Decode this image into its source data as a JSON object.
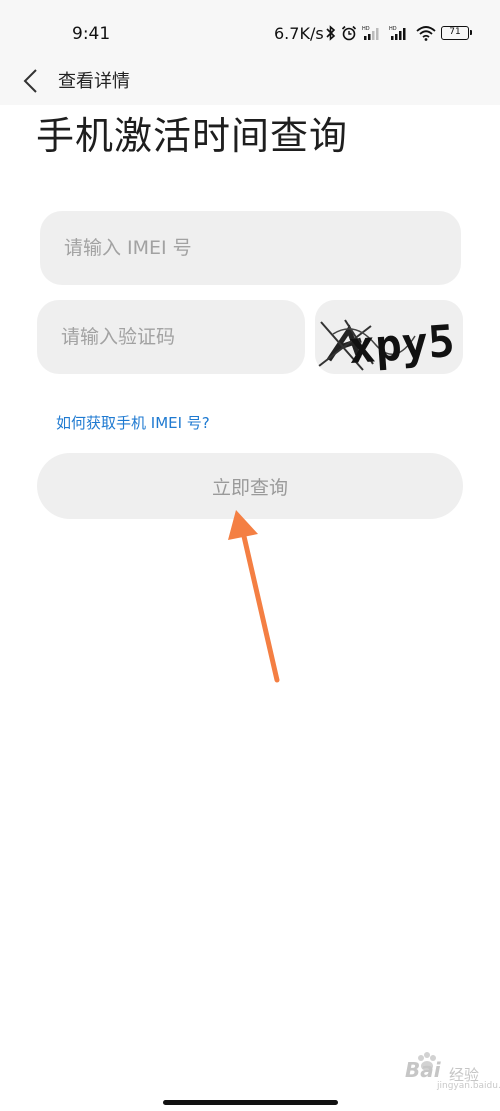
{
  "status_bar": {
    "time": "9:41",
    "network_speed": "6.7K/s",
    "battery": "71"
  },
  "header": {
    "title": "查看详情"
  },
  "page": {
    "title": "手机激活时间查询"
  },
  "form": {
    "imei_placeholder": "请输入 IMEI 号",
    "captcha_placeholder": "请输入验证码",
    "captcha_text": "xpy5",
    "help_link": "如何获取手机 IMEI 号?",
    "submit_label": "立即查询"
  },
  "annotation": {
    "arrow_color": "#f47f43"
  },
  "watermark": {
    "brand": "Bai",
    "brand_sub": "经验",
    "url": "jingyan.baidu.com"
  },
  "colors": {
    "link": "#1f7ad1",
    "field_bg": "#efefef",
    "header_bg": "#f7f7f7"
  }
}
